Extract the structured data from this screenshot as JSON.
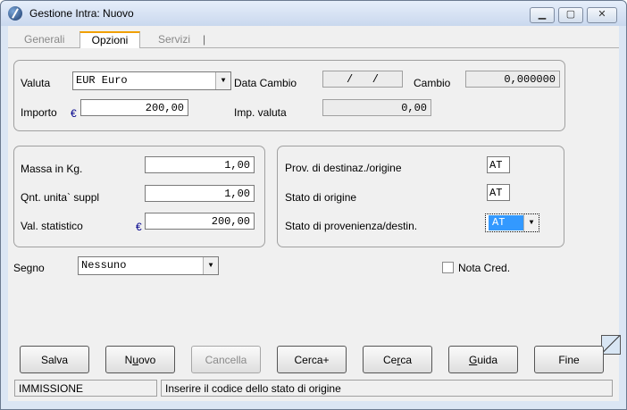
{
  "window": {
    "title": "Gestione Intra: Nuovo"
  },
  "tabs": [
    "Generali",
    "Opzioni",
    "Servizi"
  ],
  "currency_group": {
    "valuta_label": "Valuta",
    "valuta_value": "EUR Euro",
    "data_cambio_label": "Data Cambio",
    "data_cambio_value": "/   /",
    "cambio_label": "Cambio",
    "cambio_value": "0,000000",
    "importo_label": "Importo",
    "importo_value": "200,00",
    "imp_valuta_label": "Imp. valuta",
    "imp_valuta_value": "0,00",
    "currency_symbol": "€"
  },
  "quantity_group": {
    "massa_label": "Massa in Kg.",
    "massa_value": "1,00",
    "qnt_label": "Qnt. unita` suppl",
    "qnt_value": "1,00",
    "val_stat_label": "Val. statistico",
    "val_stat_value": "200,00",
    "currency_symbol": "€"
  },
  "origin_group": {
    "prov_label": "Prov. di destinaz./origine",
    "prov_value": "AT",
    "stato_origine_label": "Stato di origine",
    "stato_origine_value": "AT",
    "stato_prov_label": "Stato di provenienza/destin.",
    "stato_prov_value": "AT"
  },
  "segno": {
    "label": "Segno",
    "value": "Nessuno"
  },
  "nota_cred": {
    "label": "Nota Cred.",
    "checked": false
  },
  "buttons": {
    "salva": {
      "pre": "",
      "u": "",
      "post": "Salva"
    },
    "nuovo": {
      "pre": "N",
      "u": "u",
      "post": "ovo"
    },
    "cancella": {
      "pre": "",
      "u": "",
      "post": "Cancella"
    },
    "cerca_plus": {
      "pre": "",
      "u": "",
      "post": "Cerca+"
    },
    "cerca": {
      "pre": "Ce",
      "u": "r",
      "post": "ca"
    },
    "guida": {
      "pre": "",
      "u": "G",
      "post": "uida"
    },
    "fine": {
      "pre": "",
      "u": "",
      "post": "Fine"
    }
  },
  "statusbar": {
    "mode": "IMMISSIONE",
    "message": "Inserire il codice dello stato di origine"
  },
  "colors": {
    "selection": "#3399ff",
    "tab_accent": "#f0a000"
  },
  "icons": {
    "app": "app-icon",
    "minimize": "minimize-icon",
    "maximize": "maximize-icon",
    "close": "close-icon",
    "dropdown": "chevron-down-icon"
  }
}
